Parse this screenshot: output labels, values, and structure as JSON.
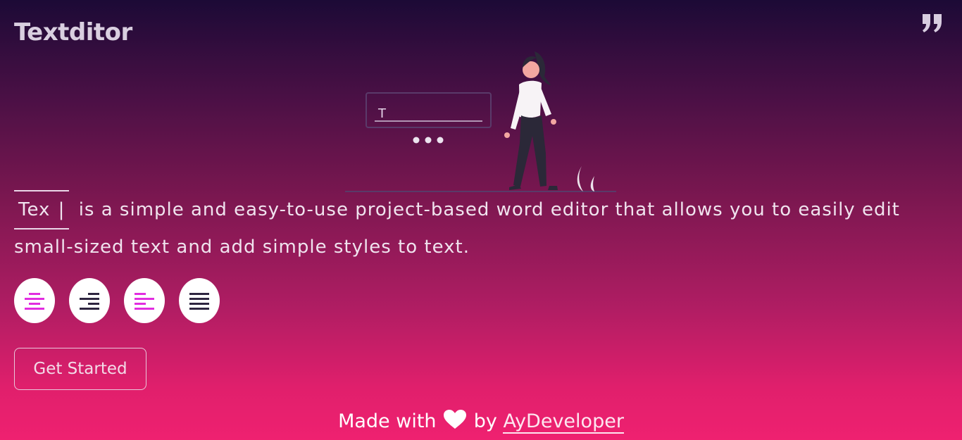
{
  "header": {
    "brand": "Textditor",
    "quote_icon": "quote-icon"
  },
  "illustration": {
    "icon": "woman-typing-illustration",
    "input_sample": "T"
  },
  "tagline": {
    "typed_text": "Tex",
    "cursor": "|",
    "text": "is a simple and easy-to-use project-based word editor that allows you to easily edit small-sized text and add simple styles to text."
  },
  "align_buttons": [
    {
      "icon": "align-center-icon",
      "color": "#e12de0"
    },
    {
      "icon": "align-right-icon",
      "color": "#2e2540"
    },
    {
      "icon": "align-left-icon",
      "color": "#e12de0"
    },
    {
      "icon": "align-justify-icon",
      "color": "#2e2540"
    }
  ],
  "cta": {
    "label": "Get Started"
  },
  "footer": {
    "prefix": "Made with",
    "heart_icon": "heart-icon",
    "by": "by",
    "author": "AyDeveloper"
  },
  "colors": {
    "accent": "#e12de0",
    "dark": "#2e2540",
    "gradient_top": "#1c0a36",
    "gradient_bottom": "#ef2170"
  }
}
